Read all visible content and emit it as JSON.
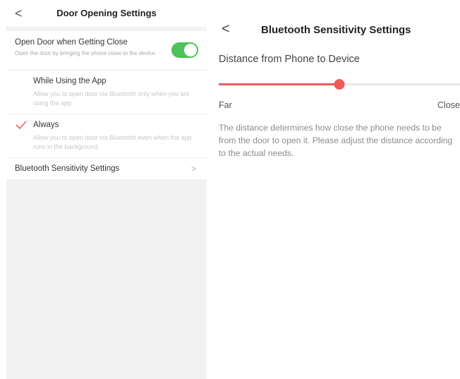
{
  "left_screen": {
    "nav": {
      "back_glyph": "<",
      "title": "Door Opening Settings"
    },
    "open_door": {
      "title": "Open Door when Getting Close",
      "subtitle": "Open the door by bringing the phone close to the device.",
      "toggle_on": true,
      "toggle_color": "#4cc35a"
    },
    "options": [
      {
        "title": "While Using the App",
        "description": "Allow you to open door via Bluetooth only when you are using the app.",
        "selected": false
      },
      {
        "title": "Always",
        "description": "Allow you to open door via Bluetooth even when the app runs in the background.",
        "selected": true
      }
    ],
    "bluetooth_row": {
      "label": "Bluetooth Sensitivity Settings",
      "chevron": ">"
    }
  },
  "right_screen": {
    "nav": {
      "back_glyph": "<",
      "title": "Bluetooth Sensitivity Settings"
    },
    "heading": "Distance from Phone to Device",
    "slider": {
      "value_fraction": 0.5,
      "accent_color": "#ef5b5b"
    },
    "label_far": "Far",
    "label_close": "Close",
    "description": "The distance determines how close the phone needs to be from the door to open it. Please adjust the distance according to the actual needs."
  },
  "icons": {
    "back": "chevron-left-icon",
    "check": "checkmark-icon",
    "chevron": "chevron-right-icon"
  }
}
